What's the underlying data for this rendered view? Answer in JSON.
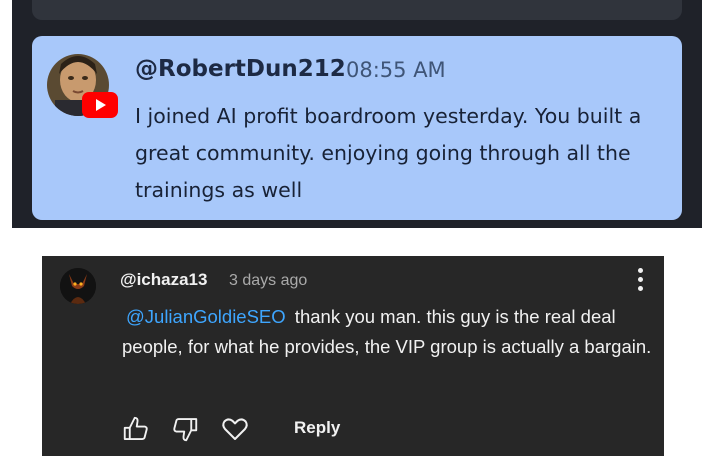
{
  "chat": {
    "username": "@RobertDun212",
    "time": "08:55 AM",
    "message": "I joined AI profit boardroom yesterday. You built a great community. enjoying going through all the trainings as well",
    "avatar_icon": "portrait-avatar",
    "badge_icon": "youtube-icon",
    "card_color": "#a8c8fa"
  },
  "comment": {
    "username": "@ichaza13",
    "time": "3 days ago",
    "mention": "@JulianGoldieSEO",
    "text": " thank you man. this guy is the real deal people, for what he provides, the VIP group is actually a bargain.",
    "reply_label": "Reply",
    "icons": [
      "thumbs-up-icon",
      "thumbs-down-icon",
      "heart-icon",
      "more-vertical-icon"
    ],
    "mention_color": "#3ea6ff"
  }
}
